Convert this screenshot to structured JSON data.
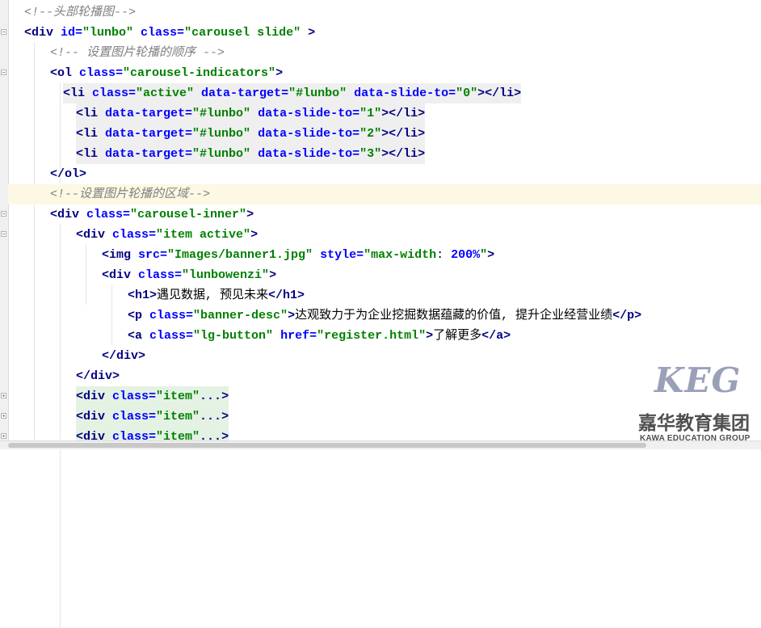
{
  "editor": {
    "lines": [
      {
        "indent": 1,
        "tokens": [
          {
            "t": "cm",
            "v": "<!--头部轮播图-->"
          }
        ]
      },
      {
        "indent": 1,
        "tokens": [
          {
            "t": "tg",
            "v": "<div "
          },
          {
            "t": "at",
            "v": "id="
          },
          {
            "t": "st",
            "v": "\"lunbo\" "
          },
          {
            "t": "at",
            "v": "class="
          },
          {
            "t": "st",
            "v": "\"carousel slide\" "
          },
          {
            "t": "tg",
            "v": ">"
          }
        ]
      },
      {
        "indent": 2,
        "tokens": [
          {
            "t": "cm",
            "v": "<!-- 设置图片轮播的顺序 -->"
          }
        ]
      },
      {
        "indent": 2,
        "tokens": [
          {
            "t": "tg",
            "v": "<ol "
          },
          {
            "t": "at",
            "v": "class="
          },
          {
            "t": "st",
            "v": "\"carousel-indicators\""
          },
          {
            "t": "tg",
            "v": ">"
          }
        ]
      },
      {
        "indent": 3,
        "shade": true,
        "tokens": [
          {
            "t": "tg",
            "v": "<li "
          },
          {
            "t": "at",
            "v": "class="
          },
          {
            "t": "st",
            "v": "\"active\" "
          },
          {
            "t": "at",
            "v": "data-target="
          },
          {
            "t": "st",
            "v": "\"#lunbo\" "
          },
          {
            "t": "at",
            "v": "data-slide-to="
          },
          {
            "t": "st",
            "v": "\"0\""
          },
          {
            "t": "tg",
            "v": "></li>"
          }
        ]
      },
      {
        "indent": 4,
        "shade": true,
        "tokens": [
          {
            "t": "tg",
            "v": "<li "
          },
          {
            "t": "at",
            "v": "data-target="
          },
          {
            "t": "st",
            "v": "\"#lunbo\" "
          },
          {
            "t": "at",
            "v": "data-slide-to="
          },
          {
            "t": "st",
            "v": "\"1\""
          },
          {
            "t": "tg",
            "v": "></li>"
          }
        ]
      },
      {
        "indent": 4,
        "shade": true,
        "tokens": [
          {
            "t": "tg",
            "v": "<li "
          },
          {
            "t": "at",
            "v": "data-target="
          },
          {
            "t": "st",
            "v": "\"#lunbo\" "
          },
          {
            "t": "at",
            "v": "data-slide-to="
          },
          {
            "t": "st",
            "v": "\"2\""
          },
          {
            "t": "tg",
            "v": "></li>"
          }
        ]
      },
      {
        "indent": 4,
        "shade": true,
        "tokens": [
          {
            "t": "tg",
            "v": "<li "
          },
          {
            "t": "at",
            "v": "data-target="
          },
          {
            "t": "st",
            "v": "\"#lunbo\" "
          },
          {
            "t": "at",
            "v": "data-slide-to="
          },
          {
            "t": "st",
            "v": "\"3\""
          },
          {
            "t": "tg",
            "v": "></li>"
          }
        ]
      },
      {
        "indent": 2,
        "tokens": [
          {
            "t": "tg",
            "v": "</ol>"
          }
        ]
      },
      {
        "indent": 2,
        "highlight": true,
        "tokens": [
          {
            "t": "cm",
            "v": "<!--设置图片轮播的区域-->"
          }
        ]
      },
      {
        "indent": 2,
        "tokens": [
          {
            "t": "tg",
            "v": "<div "
          },
          {
            "t": "at",
            "v": "class="
          },
          {
            "t": "st",
            "v": "\"carousel-inner\""
          },
          {
            "t": "tg",
            "v": ">"
          }
        ]
      },
      {
        "indent": 3,
        "tokens": [
          {
            "t": "tg",
            "v": "<div "
          },
          {
            "t": "at",
            "v": "class="
          },
          {
            "t": "st",
            "v": "\"item active\""
          },
          {
            "t": "tg",
            "v": ">"
          }
        ]
      },
      {
        "indent": 4,
        "tokens": [
          {
            "t": "tg",
            "v": "<img "
          },
          {
            "t": "at",
            "v": "src="
          },
          {
            "t": "st",
            "v": "\"Images/banner1.jpg\" "
          },
          {
            "t": "at",
            "v": "style="
          },
          {
            "t": "st",
            "v": "\"max-width"
          },
          {
            "t": "tx",
            "v": ": "
          },
          {
            "t": "at",
            "v": "200%"
          },
          {
            "t": "st",
            "v": "\""
          },
          {
            "t": "tg",
            "v": ">"
          }
        ]
      },
      {
        "indent": 4,
        "tokens": [
          {
            "t": "tg",
            "v": "<div "
          },
          {
            "t": "at",
            "v": "class="
          },
          {
            "t": "st",
            "v": "\"lunbowenzi\""
          },
          {
            "t": "tg",
            "v": ">"
          }
        ]
      },
      {
        "indent": 5,
        "tokens": [
          {
            "t": "tg",
            "v": "<h1>"
          },
          {
            "t": "tx",
            "v": "遇见数据, 预见未来"
          },
          {
            "t": "tg",
            "v": "</h1>"
          }
        ]
      },
      {
        "indent": 5,
        "tokens": [
          {
            "t": "tg",
            "v": "<p "
          },
          {
            "t": "at",
            "v": "class="
          },
          {
            "t": "st",
            "v": "\"banner-desc\""
          },
          {
            "t": "tg",
            "v": ">"
          },
          {
            "t": "tx",
            "v": "达观致力于为企业挖掘数据蕴藏的价值, 提升企业经营业绩"
          },
          {
            "t": "tg",
            "v": "</p>"
          }
        ]
      },
      {
        "indent": 5,
        "tokens": [
          {
            "t": "tg",
            "v": "<a "
          },
          {
            "t": "at",
            "v": "class="
          },
          {
            "t": "st",
            "v": "\"lg-button\" "
          },
          {
            "t": "at",
            "v": "href="
          },
          {
            "t": "st",
            "v": "\"register.html\""
          },
          {
            "t": "tg",
            "v": ">"
          },
          {
            "t": "tx",
            "v": "了解更多"
          },
          {
            "t": "tg",
            "v": "</a>"
          }
        ]
      },
      {
        "indent": 4,
        "tokens": [
          {
            "t": "tg",
            "v": "</div>"
          }
        ]
      },
      {
        "indent": 3,
        "tokens": [
          {
            "t": "tg",
            "v": "</div>"
          }
        ]
      },
      {
        "indent": 3,
        "fold": true,
        "tokens": [
          {
            "t": "tg",
            "v": "<div "
          },
          {
            "t": "at",
            "v": "class="
          },
          {
            "t": "st",
            "v": "\"item\""
          },
          {
            "t": "tg",
            "v": "..."
          },
          {
            "t": "tg",
            "v": ">"
          }
        ]
      },
      {
        "indent": 3,
        "fold": true,
        "tokens": [
          {
            "t": "tg",
            "v": "<div "
          },
          {
            "t": "at",
            "v": "class="
          },
          {
            "t": "st",
            "v": "\"item\""
          },
          {
            "t": "tg",
            "v": "..."
          },
          {
            "t": "tg",
            "v": ">"
          }
        ]
      },
      {
        "indent": 3,
        "fold": true,
        "tokens": [
          {
            "t": "tg",
            "v": "<div "
          },
          {
            "t": "at",
            "v": "class="
          },
          {
            "t": "st",
            "v": "\"item\""
          },
          {
            "t": "tg",
            "v": "..."
          },
          {
            "t": "tg",
            "v": ">"
          }
        ]
      }
    ]
  },
  "watermark": {
    "logo": "KEG",
    "name_cn": "嘉华教育集团",
    "name_en": "KAWA EDUCATION GROUP"
  }
}
